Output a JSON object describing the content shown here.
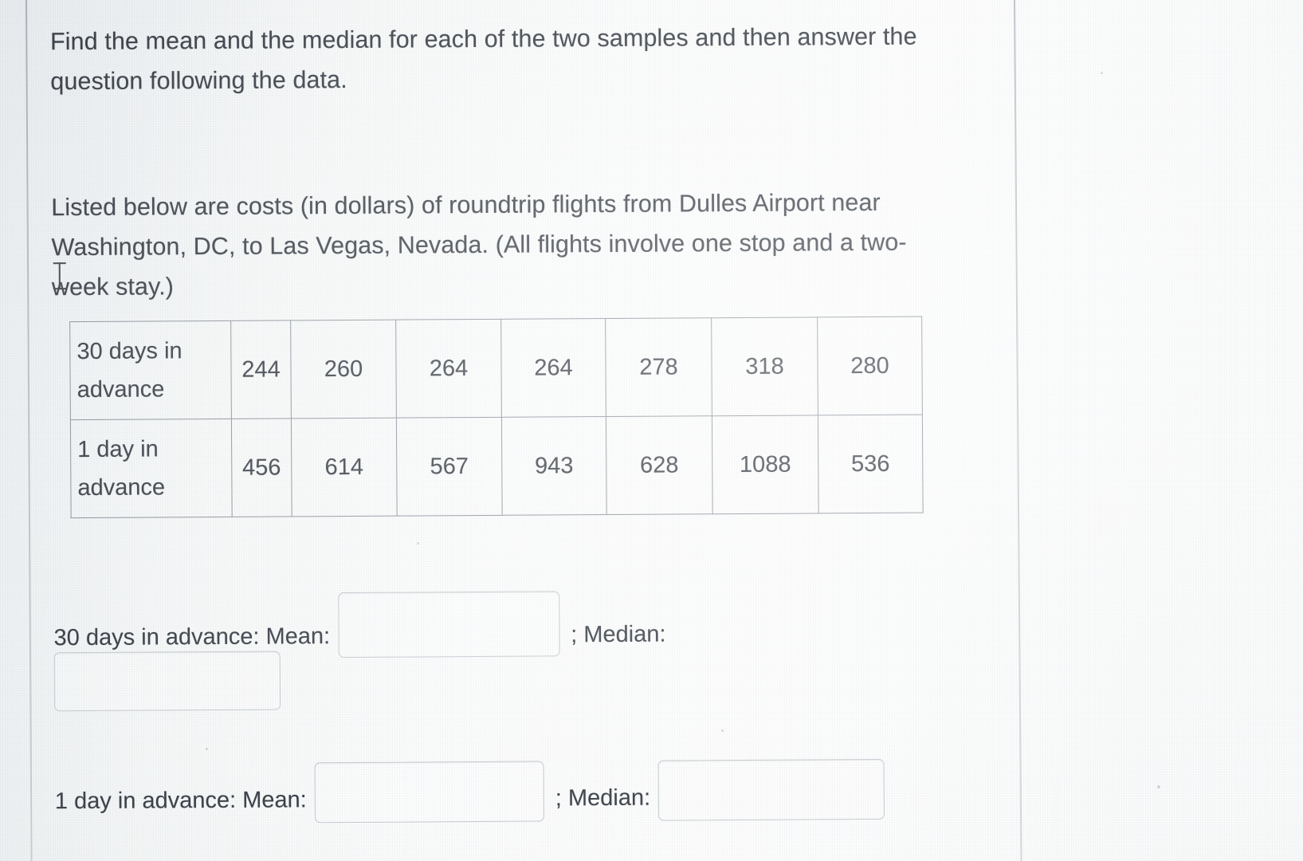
{
  "instructions": {
    "paragraph_1": "Find the mean and the median for each of the two samples and then answer the question following the data.",
    "paragraph_2": "Listed below are costs (in dollars) of roundtrip flights from Dulles Airport near Washington, DC, to Las Vegas, Nevada. (All flights involve one stop and a two-week stay.)"
  },
  "data_table": {
    "rows": [
      {
        "label": "30 days in advance",
        "values": [
          "244",
          "260",
          "264",
          "264",
          "278",
          "318",
          "280"
        ]
      },
      {
        "label": "1 day in advance",
        "values": [
          "456",
          "614",
          "567",
          "943",
          "628",
          "1088",
          "536"
        ]
      }
    ]
  },
  "answers": {
    "row_30_days": {
      "prefix_label": "30 days in advance: Mean:",
      "mean_value": "",
      "separator": "; Median:",
      "median_value": ""
    },
    "row_1_day": {
      "prefix_label": "1 day in advance: Mean:",
      "mean_value": "",
      "separator": "; Median:",
      "median_value": ""
    }
  },
  "colors": {
    "text": "#3c424a",
    "table_border": "#8d959d",
    "input_border": "#c6cdd2",
    "background": "#fafbfc"
  }
}
